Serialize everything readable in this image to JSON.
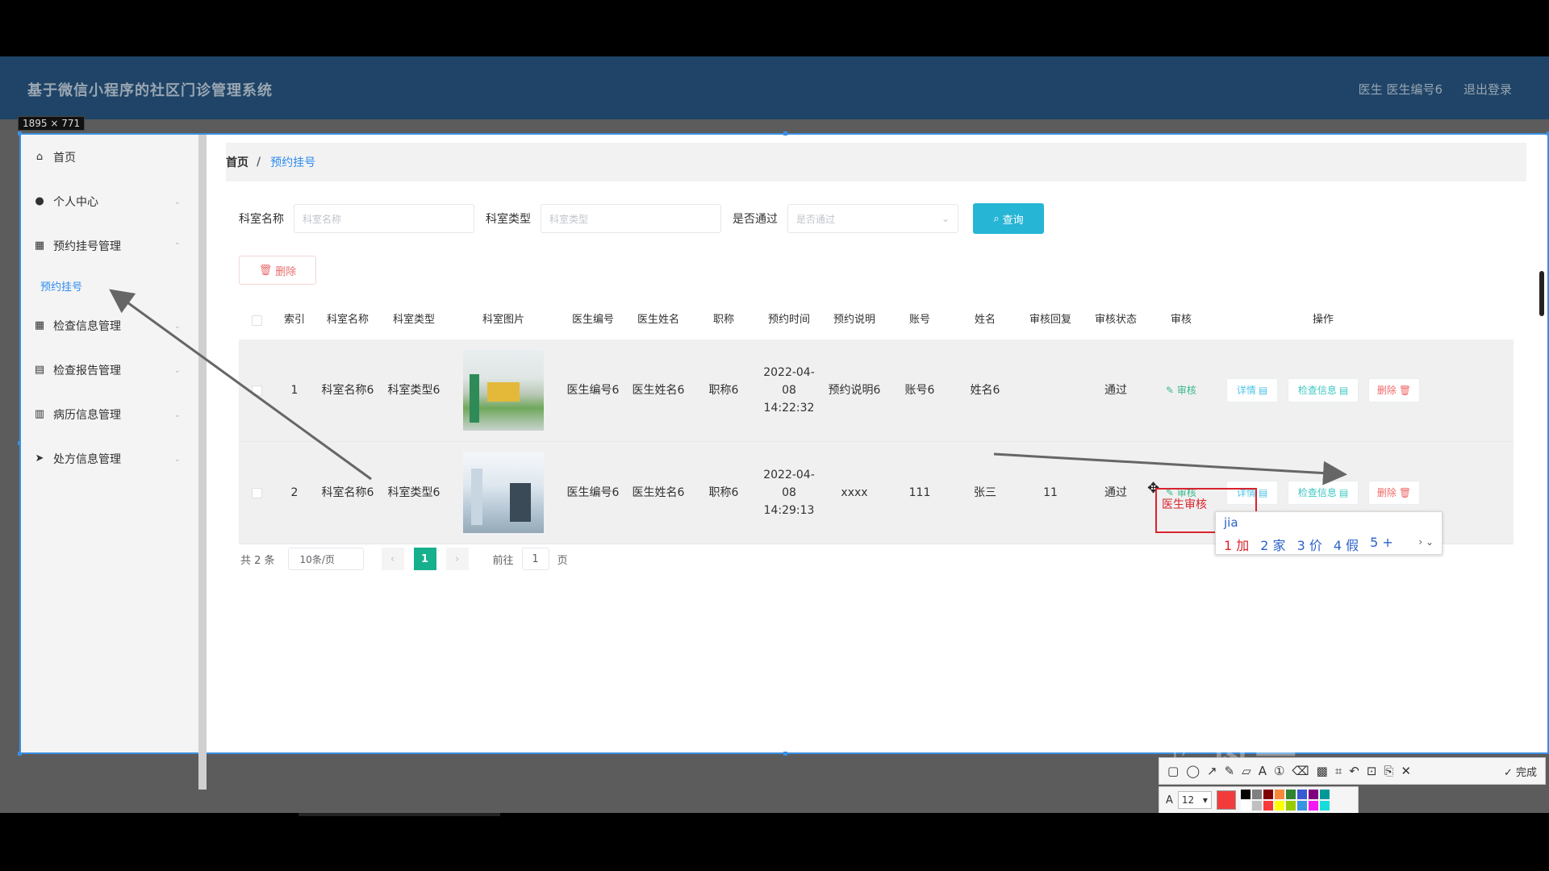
{
  "app": {
    "title": "基于微信小程序的社区门诊管理系统",
    "header_links": [
      "医生 医生编号6",
      "退出登录"
    ]
  },
  "capture_size_label": "1895 × 771",
  "sidebar": {
    "items": [
      {
        "label": "首页",
        "icon": "home-icon"
      },
      {
        "label": "个人中心",
        "icon": "user-icon"
      },
      {
        "label": "预约挂号管理",
        "icon": "grid-icon"
      },
      {
        "label": "检查信息管理",
        "icon": "grid-icon"
      },
      {
        "label": "检查报告管理",
        "icon": "printer-icon"
      },
      {
        "label": "病历信息管理",
        "icon": "document-icon"
      },
      {
        "label": "处方信息管理",
        "icon": "send-icon"
      }
    ],
    "active_sub": "预约挂号"
  },
  "breadcrumb": {
    "home": "首页",
    "separator": "/",
    "current": "预约挂号"
  },
  "search": {
    "dept_name_label": "科室名称",
    "dept_name_placeholder": "科室名称",
    "dept_type_label": "科室类型",
    "dept_type_placeholder": "科室类型",
    "passed_label": "是否通过",
    "passed_placeholder": "是否通过",
    "search_button": "查询"
  },
  "toolbar": {
    "delete_button": "删除"
  },
  "table": {
    "columns": [
      "索引",
      "科室名称",
      "科室类型",
      "科室图片",
      "医生编号",
      "医生姓名",
      "职称",
      "预约时间",
      "预约说明",
      "账号",
      "姓名",
      "审核回复",
      "审核状态",
      "审核",
      "操作"
    ],
    "rows": [
      {
        "index": "1",
        "dept_name": "科室名称6",
        "dept_type": "科室类型6",
        "doctor_no": "医生编号6",
        "doctor_name": "医生姓名6",
        "title": "职称6",
        "time": "2022-04-08 14:22:32",
        "note": "预约说明6",
        "account": "账号6",
        "name": "姓名6",
        "reply": "",
        "status": "通过",
        "audit": "审核"
      },
      {
        "index": "2",
        "dept_name": "科室名称6",
        "dept_type": "科室类型6",
        "doctor_no": "医生编号6",
        "doctor_name": "医生姓名6",
        "title": "职称6",
        "time": "2022-04-08 14:29:13",
        "note": "xxxx",
        "account": "111",
        "name": "张三",
        "reply": "11",
        "status": "通过",
        "audit": "审核"
      }
    ],
    "actions": {
      "detail": "详情",
      "check_info": "检查信息",
      "delete": "删除"
    }
  },
  "pagination": {
    "total": "共 2 条",
    "page_size": "10条/页",
    "current_page": "1",
    "goto_label": "前往",
    "goto_value": "1",
    "page_unit": "页"
  },
  "annotation": {
    "text": "医生审核"
  },
  "ime": {
    "input": "jia",
    "candidates": [
      "1 加",
      "2 家",
      "3 价",
      "4 假",
      "5 +"
    ]
  },
  "capture_tool": {
    "done": "完成",
    "font_size": "12"
  },
  "colors": {
    "header_bg": "#1f4467",
    "primary_blue": "#2d8cf0",
    "search_button": "#26b5d5",
    "page_active": "#16b08d",
    "danger": "#f06a6a",
    "annotation_red": "#d9232d"
  }
}
